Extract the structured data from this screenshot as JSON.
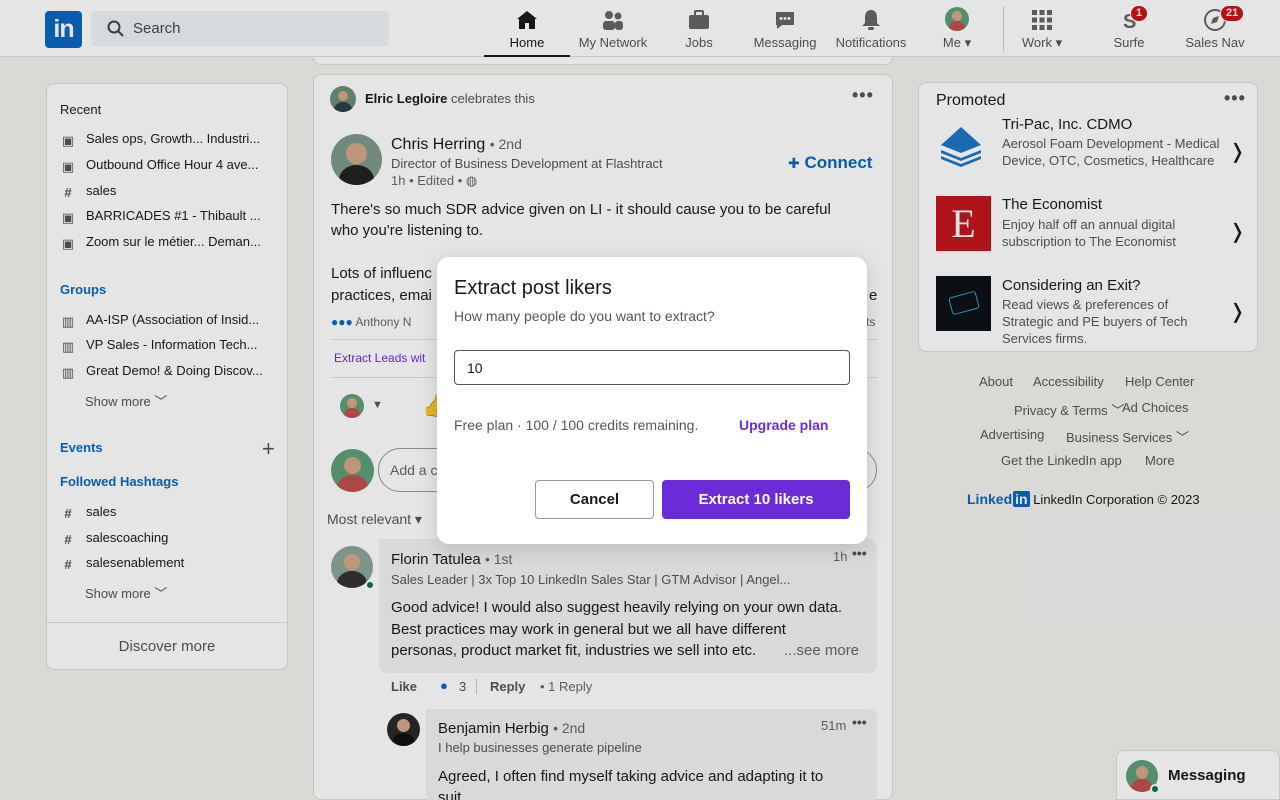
{
  "nav": {
    "search_placeholder": "Search",
    "items": [
      {
        "label": "Home",
        "icon": "home-icon"
      },
      {
        "label": "My Network",
        "icon": "network-icon"
      },
      {
        "label": "Jobs",
        "icon": "jobs-icon"
      },
      {
        "label": "Messaging",
        "icon": "messaging-icon"
      },
      {
        "label": "Notifications",
        "icon": "bell-icon"
      },
      {
        "label": "Me",
        "icon": "avatar"
      },
      {
        "label": "Work",
        "icon": "grid-icon"
      },
      {
        "label": "Surfe",
        "icon": "surfe-icon",
        "badge": "1"
      },
      {
        "label": "Sales Nav",
        "icon": "compass-icon",
        "badge": "21"
      }
    ]
  },
  "sidebar": {
    "recent_title": "Recent",
    "recent": [
      {
        "label": "Sales ops, Growth... Industri...",
        "icon": "calendar-icon"
      },
      {
        "label": "Outbound Office Hour 4 ave...",
        "icon": "calendar-icon"
      },
      {
        "label": "sales",
        "icon": "hashtag-icon"
      },
      {
        "label": "BARRICADES #1 - Thibault ...",
        "icon": "calendar-icon"
      },
      {
        "label": "Zoom sur le métier... Deman...",
        "icon": "calendar-icon"
      }
    ],
    "groups_title": "Groups",
    "groups": [
      {
        "label": "AA-ISP (Association of Insid..."
      },
      {
        "label": "VP Sales - Information Tech..."
      },
      {
        "label": "Great Demo! & Doing Discov..."
      }
    ],
    "show_more": "Show more",
    "events_title": "Events",
    "hashtags_title": "Followed Hashtags",
    "hashtags": [
      {
        "label": "sales"
      },
      {
        "label": "salescoaching"
      },
      {
        "label": "salesenablement"
      }
    ],
    "discover_more": "Discover more"
  },
  "post": {
    "celebrator": "Elric Legloire",
    "celebrates": "celebrates this",
    "author": "Chris Herring",
    "degree": "• 2nd",
    "headline": "Director of Business Development at Flashtract",
    "meta": "1h • Edited •",
    "connect": "Connect",
    "text_line1": "There's so much SDR advice given on LI - it should cause you to be careful",
    "text_line2": "who you're listening to.",
    "text_line3": "Lots of influenc",
    "text_line4": "practices, emai",
    "text_line3_end": "e",
    "reactions_name": "Anthony N",
    "reactions_end": "ts",
    "extract_leads": "Extract Leads wit",
    "comment_placeholder": "Add a c",
    "sort_label": "Most relevant"
  },
  "comments": [
    {
      "author": "Florin Tatulea",
      "degree": "• 1st",
      "time": "1h",
      "headline": "Sales Leader | 3x Top 10 LinkedIn Sales Star | GTM Advisor | Angel...",
      "line1": "Good advice! I would also suggest heavily relying on your own data.",
      "line2": "Best practices may work in general but we all have different",
      "line3": "personas, product market fit, industries we sell into etc.",
      "see_more": "...see more",
      "like": "Like",
      "like_count": "3",
      "reply": "Reply",
      "replies": "1 Reply"
    },
    {
      "author": "Benjamin Herbig",
      "degree": "• 2nd",
      "time": "51m",
      "headline": "I help businesses generate pipeline",
      "line1": "Agreed, I often find myself taking advice and adapting it to",
      "line2": "suit"
    }
  ],
  "promoted": {
    "title": "Promoted",
    "ads": [
      {
        "name": "Tri-Pac, Inc. CDMO",
        "line1": "Aerosol Foam Development - Medical",
        "line2": "Device, OTC, Cosmetics, Healthcare"
      },
      {
        "name": "The Economist",
        "line1": "Enjoy half off an annual digital",
        "line2": "subscription to The Economist",
        "logo_letter": "E"
      },
      {
        "name": "Considering an Exit?",
        "line1": "Read views & preferences of",
        "line2": "Strategic and PE buyers of Tech",
        "line3": "Services firms."
      }
    ]
  },
  "footer": {
    "about": "About",
    "accessibility": "Accessibility",
    "help": "Help Center",
    "privacy": "Privacy & Terms",
    "ad_choices": "Ad Choices",
    "advertising": "Advertising",
    "business": "Business Services",
    "get_app": "Get the LinkedIn app",
    "more": "More",
    "brand": "Linked",
    "brand_in": "in",
    "copyright": "LinkedIn Corporation © 2023"
  },
  "messaging_bar": {
    "label": "Messaging"
  },
  "modal": {
    "title": "Extract post likers",
    "subtitle": "How many people do you want to extract?",
    "input_value": "10",
    "credits": "Free plan · 100 / 100 credits remaining.",
    "upgrade": "Upgrade plan",
    "cancel": "Cancel",
    "extract": "Extract 10 likers"
  },
  "colors": {
    "linkedin_blue": "#0a66c2",
    "surfe_purple": "#6c2bd9",
    "badge_red": "#cc1016"
  }
}
